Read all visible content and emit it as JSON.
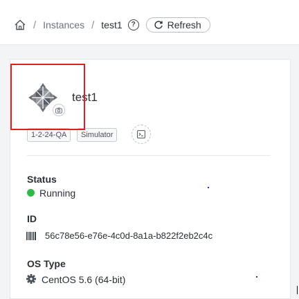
{
  "breadcrumb": {
    "items": [
      "Instances",
      "test1"
    ],
    "help_glyph": "?",
    "refresh_label": "Refresh"
  },
  "instance": {
    "name": "test1",
    "tags": [
      "1-2-24-QA",
      "Simulator"
    ],
    "status_label": "Status",
    "status_value": "Running",
    "status_color": "#2fb94a",
    "id_label": "ID",
    "id_value": "56c78e56-e76e-4c0d-8a1a-b822f2eb2c4c",
    "os_label": "OS Type",
    "os_value": "CentOS 5.6 (64-bit)"
  },
  "icons": [
    "home-icon",
    "help-icon",
    "refresh-icon",
    "centos-logo-icon",
    "camera-icon",
    "console-icon",
    "barcode-icon",
    "gear-icon"
  ],
  "colors": {
    "highlight_border": "#e02020",
    "running": "#2fb94a"
  }
}
